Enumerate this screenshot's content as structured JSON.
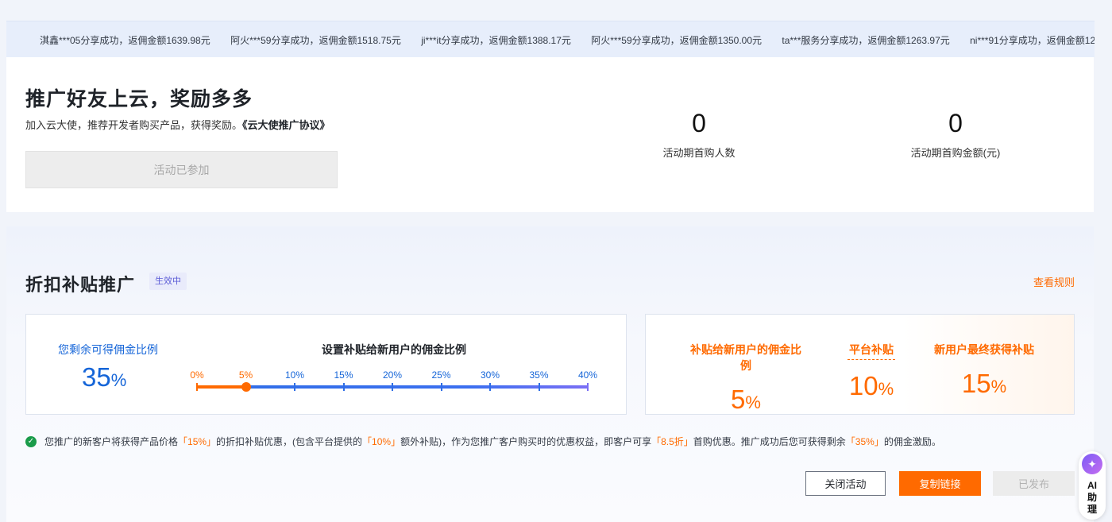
{
  "ticker": [
    "淇鑫***05分享成功，返佣金额1639.98元",
    "阿火***59分享成功，返佣金额1518.75元",
    "ji***it分享成功，返佣金额1388.17元",
    "阿火***59分享成功，返佣金额1350.00元",
    "ta***服务分享成功，返佣金额1263.97元",
    "ni***91分享成功，返佣金额12"
  ],
  "promo": {
    "title": "推广好友上云，奖励多多",
    "desc": "加入云大使，推荐开发者购买产品，获得奖励。",
    "agreement": "《云大使推广协议》",
    "joined_label": "活动已参加",
    "stat1_value": "0",
    "stat1_label": "活动期首购人数",
    "stat2_value": "0",
    "stat2_label": "活动期首购金额(元)"
  },
  "section": {
    "title": "折扣补贴推广",
    "status_badge": "生效中",
    "rules_link": "查看规则",
    "remain_label": "您剩余可得佣金比例",
    "remain_value": "35",
    "pct": "%",
    "slider_title": "设置补贴给新用户的佣金比例",
    "slider_value": 5,
    "slider_ticks": [
      "0%",
      "5%",
      "10%",
      "15%",
      "20%",
      "25%",
      "30%",
      "35%",
      "40%"
    ],
    "subsidy_label": "补贴给新用户的佣金比例",
    "subsidy_value": "5",
    "platform_label": "平台补贴",
    "platform_value": "10",
    "final_label": "新用户最终获得补贴",
    "final_value": "15"
  },
  "notice": {
    "t1": "您推广的新客户将获得产品价格",
    "v1": "「15%」",
    "t2": "的折扣补贴优惠，(包含平台提供的",
    "v2": "「10%」",
    "t3": "额外补贴)，作为您推广客户购买时的优惠权益，即客户可享",
    "v3": "「8.5折」",
    "t4": "首购优惠。推广成功后您可获得剩余",
    "v4": "「35%」",
    "t5": "的佣金激励。"
  },
  "buttons": {
    "close": "关闭活动",
    "copy": "复制链接",
    "published": "已发布"
  },
  "ai": {
    "label": "AI助理",
    "icon": "ai-sparkle-icon"
  },
  "colors": {
    "accent": "#ff6a00",
    "blue": "#1565d8",
    "success": "#1a9b4a"
  }
}
